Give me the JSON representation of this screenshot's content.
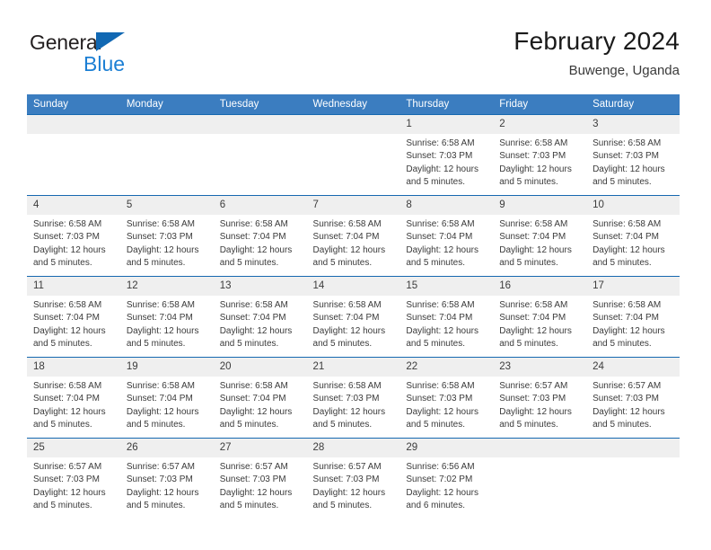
{
  "logo": {
    "top_text": "General",
    "bottom_text": "Blue",
    "accent": "#1168b3"
  },
  "header": {
    "month_title": "February 2024",
    "location": "Buwenge, Uganda"
  },
  "theme": {
    "header_bg": "#3b7dc0",
    "row_divider": "#1668b0",
    "daynum_bg": "#efefef",
    "text": "#3a3a3a"
  },
  "weekdays": [
    "Sunday",
    "Monday",
    "Tuesday",
    "Wednesday",
    "Thursday",
    "Friday",
    "Saturday"
  ],
  "weeks": [
    [
      {
        "day": "",
        "empty": true
      },
      {
        "day": "",
        "empty": true
      },
      {
        "day": "",
        "empty": true
      },
      {
        "day": "",
        "empty": true
      },
      {
        "day": "1",
        "sunrise": "Sunrise: 6:58 AM",
        "sunset": "Sunset: 7:03 PM",
        "daylight": "Daylight: 12 hours and 5 minutes."
      },
      {
        "day": "2",
        "sunrise": "Sunrise: 6:58 AM",
        "sunset": "Sunset: 7:03 PM",
        "daylight": "Daylight: 12 hours and 5 minutes."
      },
      {
        "day": "3",
        "sunrise": "Sunrise: 6:58 AM",
        "sunset": "Sunset: 7:03 PM",
        "daylight": "Daylight: 12 hours and 5 minutes."
      }
    ],
    [
      {
        "day": "4",
        "sunrise": "Sunrise: 6:58 AM",
        "sunset": "Sunset: 7:03 PM",
        "daylight": "Daylight: 12 hours and 5 minutes."
      },
      {
        "day": "5",
        "sunrise": "Sunrise: 6:58 AM",
        "sunset": "Sunset: 7:03 PM",
        "daylight": "Daylight: 12 hours and 5 minutes."
      },
      {
        "day": "6",
        "sunrise": "Sunrise: 6:58 AM",
        "sunset": "Sunset: 7:04 PM",
        "daylight": "Daylight: 12 hours and 5 minutes."
      },
      {
        "day": "7",
        "sunrise": "Sunrise: 6:58 AM",
        "sunset": "Sunset: 7:04 PM",
        "daylight": "Daylight: 12 hours and 5 minutes."
      },
      {
        "day": "8",
        "sunrise": "Sunrise: 6:58 AM",
        "sunset": "Sunset: 7:04 PM",
        "daylight": "Daylight: 12 hours and 5 minutes."
      },
      {
        "day": "9",
        "sunrise": "Sunrise: 6:58 AM",
        "sunset": "Sunset: 7:04 PM",
        "daylight": "Daylight: 12 hours and 5 minutes."
      },
      {
        "day": "10",
        "sunrise": "Sunrise: 6:58 AM",
        "sunset": "Sunset: 7:04 PM",
        "daylight": "Daylight: 12 hours and 5 minutes."
      }
    ],
    [
      {
        "day": "11",
        "sunrise": "Sunrise: 6:58 AM",
        "sunset": "Sunset: 7:04 PM",
        "daylight": "Daylight: 12 hours and 5 minutes."
      },
      {
        "day": "12",
        "sunrise": "Sunrise: 6:58 AM",
        "sunset": "Sunset: 7:04 PM",
        "daylight": "Daylight: 12 hours and 5 minutes."
      },
      {
        "day": "13",
        "sunrise": "Sunrise: 6:58 AM",
        "sunset": "Sunset: 7:04 PM",
        "daylight": "Daylight: 12 hours and 5 minutes."
      },
      {
        "day": "14",
        "sunrise": "Sunrise: 6:58 AM",
        "sunset": "Sunset: 7:04 PM",
        "daylight": "Daylight: 12 hours and 5 minutes."
      },
      {
        "day": "15",
        "sunrise": "Sunrise: 6:58 AM",
        "sunset": "Sunset: 7:04 PM",
        "daylight": "Daylight: 12 hours and 5 minutes."
      },
      {
        "day": "16",
        "sunrise": "Sunrise: 6:58 AM",
        "sunset": "Sunset: 7:04 PM",
        "daylight": "Daylight: 12 hours and 5 minutes."
      },
      {
        "day": "17",
        "sunrise": "Sunrise: 6:58 AM",
        "sunset": "Sunset: 7:04 PM",
        "daylight": "Daylight: 12 hours and 5 minutes."
      }
    ],
    [
      {
        "day": "18",
        "sunrise": "Sunrise: 6:58 AM",
        "sunset": "Sunset: 7:04 PM",
        "daylight": "Daylight: 12 hours and 5 minutes."
      },
      {
        "day": "19",
        "sunrise": "Sunrise: 6:58 AM",
        "sunset": "Sunset: 7:04 PM",
        "daylight": "Daylight: 12 hours and 5 minutes."
      },
      {
        "day": "20",
        "sunrise": "Sunrise: 6:58 AM",
        "sunset": "Sunset: 7:04 PM",
        "daylight": "Daylight: 12 hours and 5 minutes."
      },
      {
        "day": "21",
        "sunrise": "Sunrise: 6:58 AM",
        "sunset": "Sunset: 7:03 PM",
        "daylight": "Daylight: 12 hours and 5 minutes."
      },
      {
        "day": "22",
        "sunrise": "Sunrise: 6:58 AM",
        "sunset": "Sunset: 7:03 PM",
        "daylight": "Daylight: 12 hours and 5 minutes."
      },
      {
        "day": "23",
        "sunrise": "Sunrise: 6:57 AM",
        "sunset": "Sunset: 7:03 PM",
        "daylight": "Daylight: 12 hours and 5 minutes."
      },
      {
        "day": "24",
        "sunrise": "Sunrise: 6:57 AM",
        "sunset": "Sunset: 7:03 PM",
        "daylight": "Daylight: 12 hours and 5 minutes."
      }
    ],
    [
      {
        "day": "25",
        "sunrise": "Sunrise: 6:57 AM",
        "sunset": "Sunset: 7:03 PM",
        "daylight": "Daylight: 12 hours and 5 minutes."
      },
      {
        "day": "26",
        "sunrise": "Sunrise: 6:57 AM",
        "sunset": "Sunset: 7:03 PM",
        "daylight": "Daylight: 12 hours and 5 minutes."
      },
      {
        "day": "27",
        "sunrise": "Sunrise: 6:57 AM",
        "sunset": "Sunset: 7:03 PM",
        "daylight": "Daylight: 12 hours and 5 minutes."
      },
      {
        "day": "28",
        "sunrise": "Sunrise: 6:57 AM",
        "sunset": "Sunset: 7:03 PM",
        "daylight": "Daylight: 12 hours and 5 minutes."
      },
      {
        "day": "29",
        "sunrise": "Sunrise: 6:56 AM",
        "sunset": "Sunset: 7:02 PM",
        "daylight": "Daylight: 12 hours and 6 minutes."
      },
      {
        "day": "",
        "empty": true
      },
      {
        "day": "",
        "empty": true
      }
    ]
  ]
}
